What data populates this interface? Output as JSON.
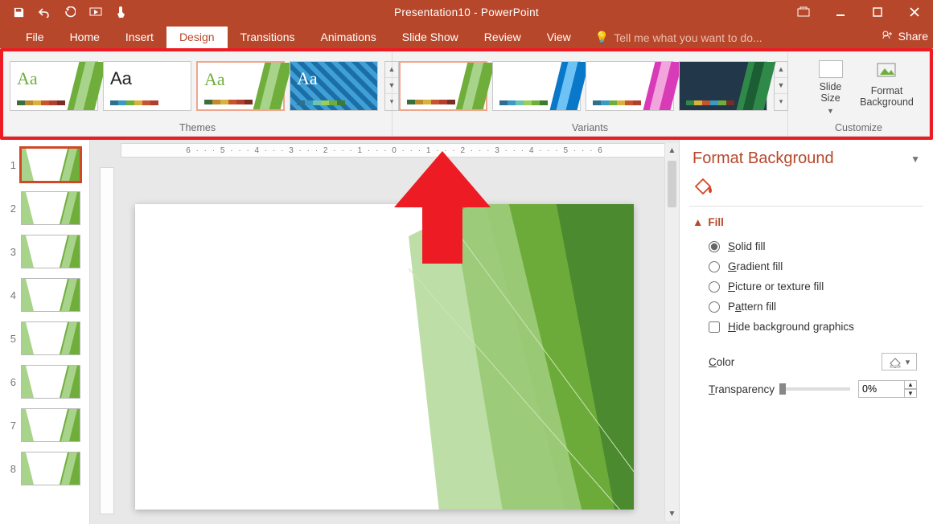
{
  "app": {
    "title": "Presentation10 - PowerPoint"
  },
  "tabs": {
    "file": "File",
    "home": "Home",
    "insert": "Insert",
    "design": "Design",
    "transitions": "Transitions",
    "animations": "Animations",
    "slideshow": "Slide Show",
    "review": "Review",
    "view": "View",
    "tell_me": "Tell me what you want to do...",
    "share": "Share"
  },
  "ribbon": {
    "themes_label": "Themes",
    "variants_label": "Variants",
    "customize_label": "Customize",
    "slide_size": "Slide\nSize",
    "format_bg": "Format\nBackground",
    "aa": "Aa"
  },
  "ruler": "6 · · · 5 · · · 4 · · · 3 · · · 2 · · · 1 · · · 0 · · · 1 · · · 2 · · · 3 · · · 4 · · · 5 · · · 6",
  "thumbs": [
    1,
    2,
    3,
    4,
    5,
    6,
    7,
    8
  ],
  "pane": {
    "title": "Format Background",
    "fill_label": "Fill",
    "solid": "Solid fill",
    "gradient": "Gradient fill",
    "picture": "Picture or texture fill",
    "pattern": "Pattern fill",
    "hide": "Hide background graphics",
    "color": "Color",
    "transparency": "Transparency",
    "transparency_value": "0%"
  },
  "swatches": {
    "warm": [
      "#3b6e3b",
      "#c08a2e",
      "#d8b23c",
      "#c6552f",
      "#b0402b",
      "#7a2e23"
    ],
    "cool": [
      "#2e6e8e",
      "#3a9ac6",
      "#6ec3b0",
      "#9bcf5a",
      "#6fae3b",
      "#3e7a2f"
    ],
    "mix": [
      "#2e6e8e",
      "#3a9ac6",
      "#6fae3b",
      "#d8b23c",
      "#c6552f",
      "#b0402b"
    ],
    "dark": [
      "#2f8a4a",
      "#d8b23c",
      "#c6552f",
      "#3a9ac6",
      "#6fae3b",
      "#7a2e23"
    ]
  }
}
